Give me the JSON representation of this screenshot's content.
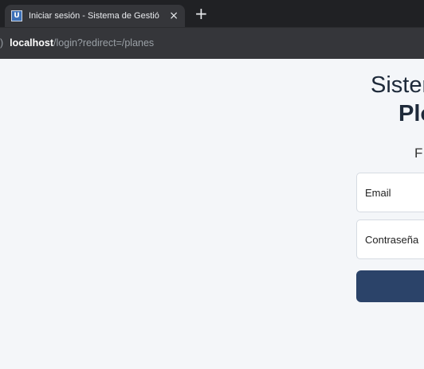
{
  "browser": {
    "tab": {
      "favicon_letter": "U",
      "title": "Iniciar sesión - Sistema de Gestió",
      "close_label": "×"
    },
    "new_tab_label": "+",
    "address": {
      "lead": ")",
      "host": "localhost",
      "path": "/login?redirect=/planes"
    }
  },
  "login": {
    "title_line1": "Sister",
    "title_line2": "Plo",
    "subtitle": "F",
    "email_placeholder": "Email",
    "password_placeholder": "Contraseña",
    "submit_label": ""
  },
  "colors": {
    "background": "#f4f6f9",
    "primary_button": "#2b4369",
    "tab_strip": "#202124",
    "toolbar": "#35363a"
  }
}
